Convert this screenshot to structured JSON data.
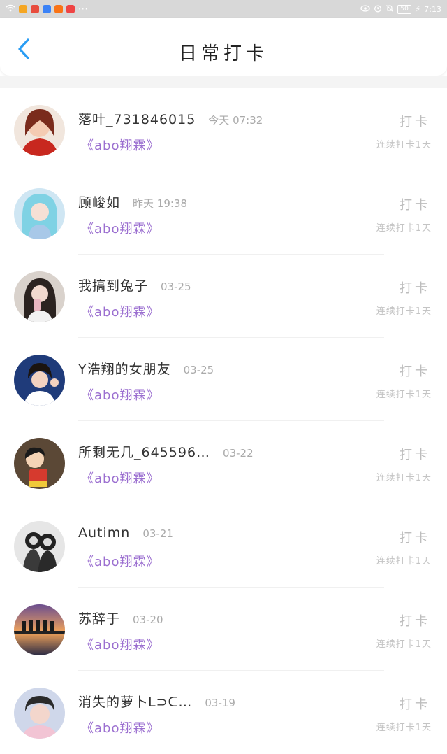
{
  "status_bar": {
    "time": "7:13",
    "battery": "50",
    "more": "···",
    "app_colors": [
      "#f5a623",
      "#e84c3d",
      "#3b82f6",
      "#f97316",
      "#ef4444"
    ]
  },
  "header": {
    "title": "日常打卡",
    "back_icon": "chevron-left-icon",
    "accent": "#2a9df4"
  },
  "list": [
    {
      "name": "落叶_731846015",
      "time": "今天 07:32",
      "topic": "《abo翔霖》",
      "action": "打卡",
      "streak": "连续打卡1天"
    },
    {
      "name": "顾峻如",
      "time": "昨天 19:38",
      "topic": "《abo翔霖》",
      "action": "打卡",
      "streak": "连续打卡1天"
    },
    {
      "name": "我搞到兔子",
      "time": "03-25",
      "topic": "《abo翔霖》",
      "action": "打卡",
      "streak": "连续打卡1天"
    },
    {
      "name": "Y浩翔的女朋友",
      "time": "03-25",
      "topic": "《abo翔霖》",
      "action": "打卡",
      "streak": "连续打卡1天"
    },
    {
      "name": "所剩无几_645596…",
      "time": "03-22",
      "topic": "《abo翔霖》",
      "action": "打卡",
      "streak": "连续打卡1天"
    },
    {
      "name": "Autimn",
      "time": "03-21",
      "topic": "《abo翔霖》",
      "action": "打卡",
      "streak": "连续打卡1天"
    },
    {
      "name": "苏辞于",
      "time": "03-20",
      "topic": "《abo翔霖》",
      "action": "打卡",
      "streak": "连续打卡1天"
    },
    {
      "name": "消失的萝卜ᒪ⊃ᑕ…",
      "time": "03-19",
      "topic": "《abo翔霖》",
      "action": "打卡",
      "streak": "连续打卡1天"
    }
  ]
}
